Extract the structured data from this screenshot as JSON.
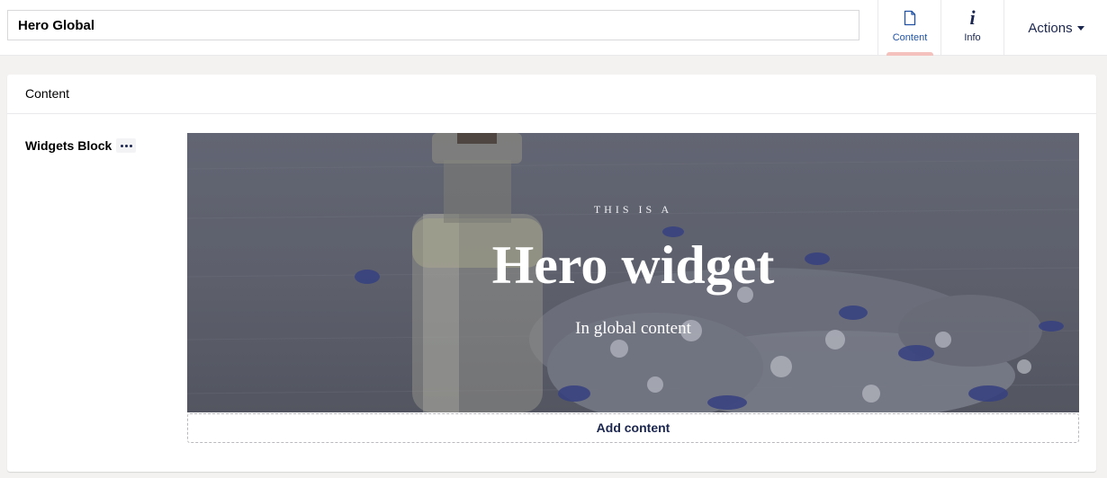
{
  "header": {
    "name_value": "Hero Global",
    "tabs": [
      {
        "label": "Content",
        "icon": "document-icon",
        "active": true
      },
      {
        "label": "Info",
        "icon": "info-icon",
        "active": false
      }
    ],
    "actions_label": "Actions"
  },
  "panel": {
    "title": "Content",
    "property": {
      "label": "Widgets Block",
      "actions_icon": "ellipsis-icon"
    },
    "hero": {
      "eyebrow": "THIS IS A",
      "title": "Hero widget",
      "subtitle": "In global content"
    },
    "add_content_label": "Add content"
  },
  "colors": {
    "accent_text": "#2152a3",
    "nav_text": "#1b264f",
    "active_indicator": "#f5c1bc",
    "page_bg": "#f3f2f1"
  }
}
